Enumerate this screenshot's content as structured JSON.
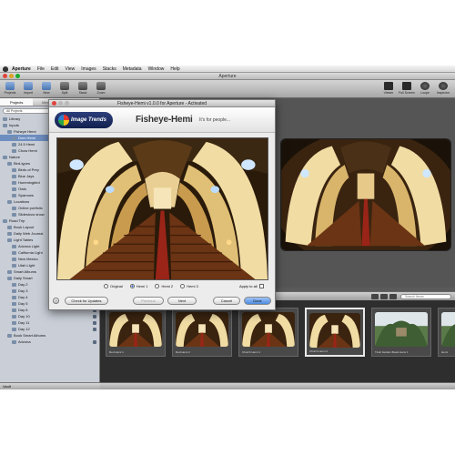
{
  "menubar": {
    "items": [
      "Aperture",
      "File",
      "Edit",
      "View",
      "Images",
      "Stacks",
      "Metadata",
      "Window",
      "Help"
    ]
  },
  "window": {
    "title": "Aperture"
  },
  "toolbar": {
    "left_buttons": [
      "Projects",
      "Import",
      "New",
      "Split",
      "Stack",
      "Zoom",
      "Full Screen",
      "Loupe",
      "Inspector"
    ],
    "right_buttons": [
      "Viewer",
      "Full Screen",
      "Loupe",
      "Inspector"
    ]
  },
  "left_panel": {
    "tabs": [
      "Projects",
      "Metadata",
      "Adjustments"
    ],
    "filter_placeholder": "All Projects",
    "tree": [
      {
        "label": "Library",
        "depth": 0,
        "selected": false
      },
      {
        "label": "Inputs",
        "depth": 0,
        "selected": false
      },
      {
        "label": "Fisheye Hemi",
        "depth": 1,
        "selected": false
      },
      {
        "label": "Dom Hemi",
        "depth": 2,
        "selected": true
      },
      {
        "label": "24.5 Hemi",
        "depth": 2,
        "selected": false
      },
      {
        "label": "Chow Hemi",
        "depth": 2,
        "selected": false
      },
      {
        "label": "Nature",
        "depth": 0,
        "selected": false
      },
      {
        "label": "Bird-types",
        "depth": 1,
        "selected": false
      },
      {
        "label": "Birds of Prey",
        "depth": 2,
        "selected": false
      },
      {
        "label": "Blue Jays",
        "depth": 2,
        "selected": false
      },
      {
        "label": "Hummingbird",
        "depth": 2,
        "selected": false
      },
      {
        "label": "Owls",
        "depth": 2,
        "selected": false
      },
      {
        "label": "Sparrows",
        "depth": 2,
        "selected": false
      },
      {
        "label": "Locations",
        "depth": 1,
        "selected": false
      },
      {
        "label": "Online portfolio",
        "depth": 2,
        "selected": false
      },
      {
        "label": "Slideshow show",
        "depth": 2,
        "selected": false
      },
      {
        "label": "Road Trip",
        "depth": 0,
        "selected": false
      },
      {
        "label": "Book Layout",
        "depth": 1,
        "selected": false
      },
      {
        "label": "Daily Web Journal",
        "depth": 1,
        "selected": false
      },
      {
        "label": "Light Tables",
        "depth": 1,
        "selected": false
      },
      {
        "label": "Arizona Light",
        "depth": 2,
        "selected": false
      },
      {
        "label": "California Light",
        "depth": 2,
        "selected": false
      },
      {
        "label": "New Mexico",
        "depth": 2,
        "selected": false
      },
      {
        "label": "Utah Light",
        "depth": 2,
        "selected": false
      },
      {
        "label": "Smart Albums",
        "depth": 1,
        "selected": false
      },
      {
        "label": "Daily Smart",
        "depth": 1,
        "selected": false
      },
      {
        "label": "Day 2",
        "depth": 2,
        "selected": false
      },
      {
        "label": "Day 3",
        "depth": 2,
        "selected": false
      },
      {
        "label": "Day 4",
        "depth": 2,
        "selected": false
      },
      {
        "label": "Day 5",
        "depth": 2,
        "selected": false
      },
      {
        "label": "Day 6",
        "depth": 2,
        "selected": false
      },
      {
        "label": "Day 10",
        "depth": 2,
        "selected": false
      },
      {
        "label": "Day 11",
        "depth": 2,
        "selected": false
      },
      {
        "label": "Day 12",
        "depth": 2,
        "selected": false
      },
      {
        "label": "Book Smart Albums",
        "depth": 1,
        "selected": false
      },
      {
        "label": "Arizona",
        "depth": 2,
        "selected": false
      }
    ],
    "bottom_label": "Vault"
  },
  "filmstrip": {
    "search_placeholder": "Search Items",
    "thumbs": [
      {
        "label": "Red Hemi 1",
        "selected": false,
        "scene": "church"
      },
      {
        "label": "Red Hemi 2",
        "selected": false,
        "scene": "church"
      },
      {
        "label": "Church Hemi 1",
        "selected": false,
        "scene": "church"
      },
      {
        "label": "Church Hemi 2",
        "selected": true,
        "scene": "church"
      },
      {
        "label": "Tivoli Garden Boats Hemi 1",
        "selected": false,
        "scene": "garden"
      },
      {
        "label": "Hemi",
        "selected": false,
        "scene": "garden"
      }
    ]
  },
  "dialog": {
    "title": "Fisheye-Hemi v1.0.0 for Aperture - Activated",
    "logo_text": "Image Trends",
    "product": "Fisheye-Hemi",
    "tagline": "It's for people...",
    "options": [
      {
        "label": "Original",
        "checked": false
      },
      {
        "label": "Hemi 1",
        "checked": true
      },
      {
        "label": "Hemi 2",
        "checked": false
      },
      {
        "label": "Hemi 3",
        "checked": false
      }
    ],
    "apply_all": "Apply to all",
    "help": "?",
    "buttons": {
      "check_updates": "Check for Updates",
      "previous": "Previous",
      "next": "Next",
      "cancel": "Cancel",
      "done": "Done"
    }
  },
  "colors": {
    "selection": "#6d8ec0",
    "default_button": "#4d8be0",
    "church_arch": "#f1dca4",
    "church_pews": "#6b3414",
    "church_floor": "#9a2418"
  }
}
